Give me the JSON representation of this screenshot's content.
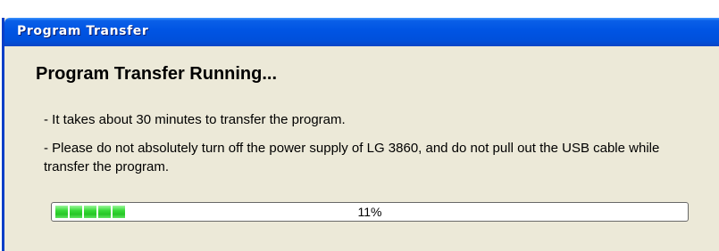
{
  "window": {
    "title": "Program Transfer"
  },
  "content": {
    "heading": "Program Transfer Running...",
    "messages": [
      "- It takes about 30 minutes to transfer the program.",
      "- Please do not absolutely turn off the power supply of LG 3860, and do not pull out the USB cable while transfer the program."
    ]
  },
  "progress": {
    "label": "11%",
    "value_percent": 11
  },
  "colors": {
    "titlebar": "#0054E3",
    "window_bg": "#ECE9D8",
    "progress_fill": "#37DA37"
  }
}
